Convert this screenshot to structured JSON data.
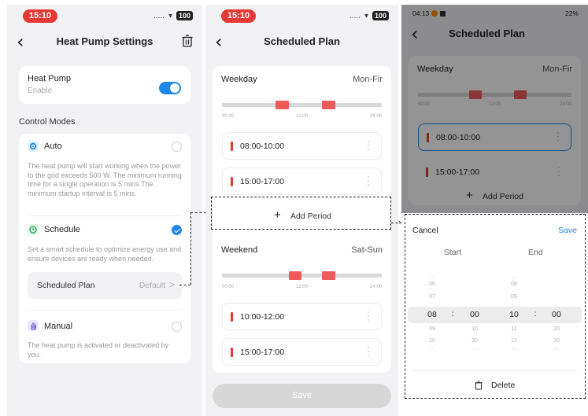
{
  "screen1": {
    "status_time": "15:10",
    "status_signal": ".....",
    "status_battery": "100",
    "title": "Heat Pump Settings",
    "heat_pump": {
      "label": "Heat Pump",
      "sub": "Enable",
      "enabled": true
    },
    "control_modes_label": "Control Modes",
    "auto": {
      "label": "Auto",
      "desc": "The heat pump will start working when the power to the grid exceeds 500 W. The minimum running time for a single operation is 5 mins.The minimum startup interval is 5 mins.",
      "selected": false
    },
    "schedule": {
      "label": "Schedule",
      "desc": "Set a smart schedule to optimize energy use and ensure devices are ready when needed.",
      "selected": true
    },
    "scheduled_plan": {
      "label": "Scheduled Plan",
      "value": "Default",
      "chevron": ">"
    },
    "manual": {
      "label": "Manual",
      "desc": "The heat pump is activated or deactivated by you.",
      "selected": false
    }
  },
  "screen2": {
    "status_time": "15:10",
    "status_signal": ".....",
    "status_battery": "100",
    "title": "Scheduled Plan",
    "weekday": {
      "label": "Weekday",
      "range": "Mon-Fir",
      "ticks": [
        "00:00",
        "12:00",
        "24:00"
      ],
      "periods": [
        "08:00-10:00",
        "15:00-17:00"
      ]
    },
    "add_period": {
      "plus": "+",
      "label": "Add Period"
    },
    "weekend": {
      "label": "Weekend",
      "range": "Sat-Sun",
      "ticks": [
        "00:00",
        "12:00",
        "24:00"
      ],
      "periods": [
        "10:00-12:00",
        "15:00-17:00"
      ]
    },
    "save_label": "Save"
  },
  "screen3": {
    "status_time": "04:13",
    "status_right": "22%",
    "title": "Scheduled Plan",
    "weekday": {
      "label": "Weekday",
      "range": "Mon-Fir",
      "ticks": [
        "00:00",
        "12:00",
        "24:00"
      ],
      "periods": [
        "08:00-10:00",
        "15:00-17:00"
      ]
    },
    "add_period": {
      "plus": "+",
      "label": "Add Period"
    },
    "picker": {
      "cancel": "Cancel",
      "save": "Save",
      "start_label": "Start",
      "end_label": "End",
      "start_hours": [
        "...",
        "06",
        "07",
        "08",
        "09",
        "10",
        "..."
      ],
      "start_minutes": [
        "00",
        "10",
        "20",
        "..."
      ],
      "end_hours": [
        "...",
        "08",
        "09",
        "10",
        "11",
        "12",
        "..."
      ],
      "end_minutes": [
        "00",
        "10",
        "20",
        "..."
      ],
      "separator": ":",
      "delete_label": "Delete"
    }
  },
  "colors": {
    "accent": "#1e88e5",
    "period_red": "#ee5a5a",
    "status_red": "#e53935",
    "background": "#f2f2f4"
  },
  "icons": [
    "back-chevron-icon",
    "trash-icon",
    "gear-icon",
    "clock-icon",
    "hand-icon",
    "plus-icon",
    "more-vertical-icon"
  ]
}
